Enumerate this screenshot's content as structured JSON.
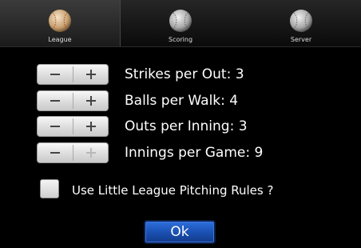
{
  "tabs": [
    {
      "label": "League",
      "selected": true,
      "icon": "baseball-icon",
      "icon_color": "#d6b48c"
    },
    {
      "label": "Scoring",
      "selected": false,
      "icon": "baseball-icon",
      "icon_color": "#bdbdbd"
    },
    {
      "label": "Server",
      "selected": false,
      "icon": "baseball-icon",
      "icon_color": "#bdbdbd"
    }
  ],
  "settings": [
    {
      "label": "Strikes per Out: 3",
      "plus_enabled": true
    },
    {
      "label": "Balls per Walk: 4",
      "plus_enabled": true
    },
    {
      "label": "Outs per Inning: 3",
      "plus_enabled": true
    },
    {
      "label": "Innings per Game: 9",
      "plus_enabled": false
    }
  ],
  "little_league": {
    "label": "Use Little League Pitching Rules ?",
    "checked": false
  },
  "ok_button": {
    "label": "Ok"
  },
  "colors": {
    "background": "#000000",
    "ok_button": "#1a4fb0"
  }
}
